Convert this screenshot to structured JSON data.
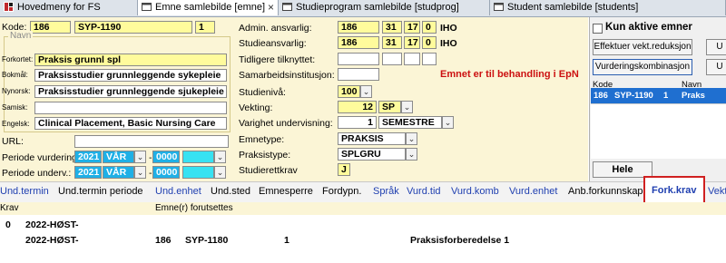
{
  "tabs": [
    {
      "label": "Hovedmeny for FS",
      "active": false
    },
    {
      "label": "Emne samlebilde  [emne]",
      "active": true
    },
    {
      "label": "Studieprogram samlebilde   [studprog]",
      "active": false
    },
    {
      "label": "Student samlebilde  [students]",
      "active": false
    }
  ],
  "form": {
    "kode_label": "Kode:",
    "kode_inst": "186",
    "kode_emne": "SYP-1190",
    "kode_versjon": "1",
    "navn_group": "Navn",
    "forkortet_label": "Forkortet:",
    "forkortet": "Praksis grunnl spl",
    "bokmal_label": "Bokmål:",
    "bokmal": "Praksisstudier grunnleggende sykepleie",
    "nynorsk_label": "Nynorsk:",
    "nynorsk": "Praksisstudier grunnleggende sjukepleie",
    "samisk_label": "Samisk:",
    "samisk": "",
    "engelsk_label": "Engelsk:",
    "engelsk": "Clinical Placement, Basic Nursing Care",
    "url_label": "URL:",
    "url": "",
    "periode_vurdering_label": "Periode vurdering:",
    "pv_year": "2021",
    "pv_term": "VÅR",
    "pv_dash": "-",
    "pv_to": "0000",
    "periode_underv_label": "Periode underv.:",
    "pu_year": "2021",
    "pu_term": "VÅR",
    "pu_dash": "-",
    "pu_to": "0000",
    "admin_label": "Admin. ansvarlig:",
    "admin": [
      "186",
      "31",
      "17",
      "0"
    ],
    "admin_code": "IHO",
    "studie_label": "Studieansvarlig:",
    "studie": [
      "186",
      "31",
      "17",
      "0"
    ],
    "studie_code": "IHO",
    "tidligere_label": "Tidligere tilknyttet:",
    "samarbeid_label": "Samarbeidsinstitusjon:",
    "status_msg": "Emnet er til behandling i EpN",
    "studieniva_label": "Studienivå:",
    "studieniva": "100",
    "vekting_label": "Vekting:",
    "vekting": "12",
    "vekting_unit": "SP",
    "varighet_label": "Varighet undervisning:",
    "varighet": "1",
    "varighet_unit": "SEMESTRE",
    "emnetype_label": "Emnetype:",
    "emnetype": "PRAKSIS",
    "praksistype_label": "Praksistype:",
    "praksistype": "SPLGRU",
    "studierettkrav_label": "Studierettkrav",
    "studierettkrav": "J"
  },
  "side": {
    "kun_aktive": "Kun aktive emner",
    "effektuer": "Effektuer vekt.reduksjon",
    "vurdkomb": "Vurderingskombinasjon",
    "btn_u1": "U",
    "btn_u2": "U",
    "col_kode": "Kode",
    "col_navn": "Navn",
    "list_row": [
      "186",
      "SYP-1190",
      "1",
      "Praks"
    ],
    "hele": "Hele"
  },
  "bottom_tabs": [
    "Und.termin",
    "Und.termin periode",
    "Und.enhet",
    "Und.sted",
    "Emnesperre",
    "Fordypn.",
    "Språk",
    "Vurd.tid",
    "Vurd.komb",
    "Vurd.enhet",
    "Anb.forkunnskap",
    "Fork.krav",
    "Vekt."
  ],
  "detail": {
    "col_krav": "Krav",
    "col_emner": "Emne(r) forutsettes",
    "row1": [
      "0",
      "2022-HØST",
      "-"
    ],
    "row2": [
      "2022-HØST",
      "-",
      "186",
      "SYP-1180",
      "1",
      "Praksisforberedelse 1"
    ]
  },
  "colors": {
    "field_yellow": "#fffb9c",
    "panel_bg": "#fbf5d6",
    "selection_blue": "#1fb0e6",
    "highlight_red": "#d02020",
    "link_blue": "#1f3fb0"
  },
  "icons": [
    "app-logo-icon",
    "window-icon",
    "close-icon",
    "chevron-down-icon",
    "checkbox-icon"
  ]
}
